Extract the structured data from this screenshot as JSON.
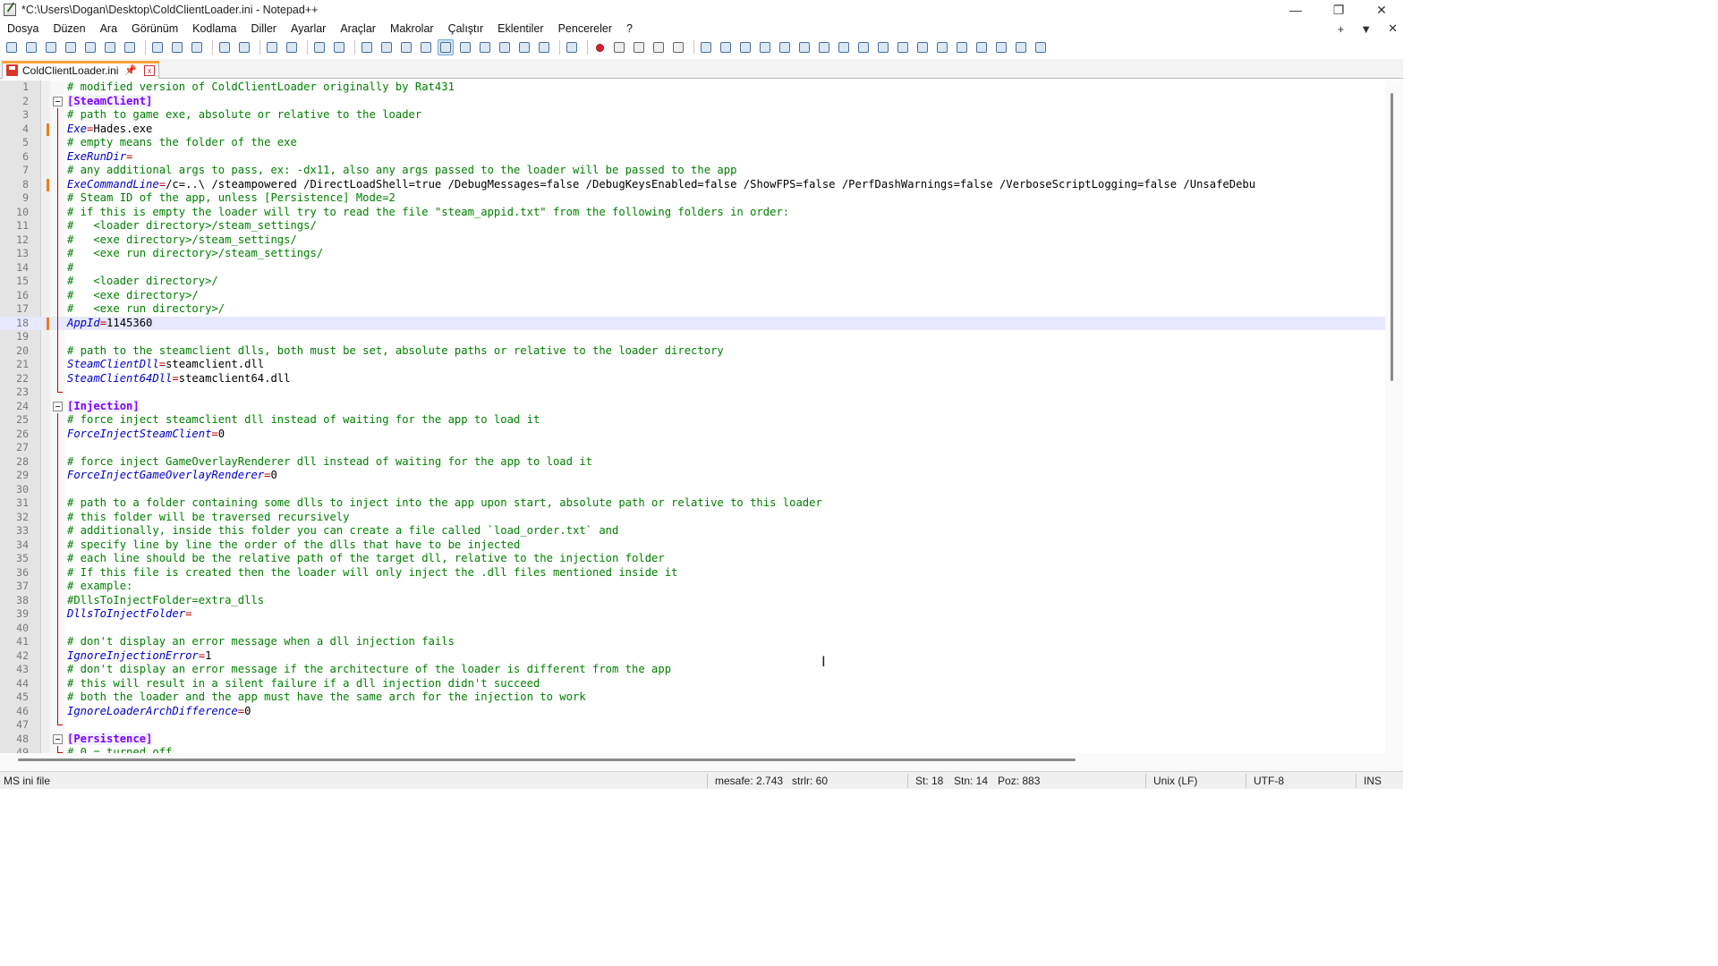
{
  "window": {
    "title": "*C:\\Users\\Dogan\\Desktop\\ColdClientLoader.ini - Notepad++",
    "minimize": "—",
    "restore": "❐",
    "close": "✕"
  },
  "menu": {
    "items": [
      "Dosya",
      "Düzen",
      "Ara",
      "Görünüm",
      "Kodlama",
      "Diller",
      "Ayarlar",
      "Araçlar",
      "Makrolar",
      "Çalıştır",
      "Eklentiler",
      "Pencereler",
      "?"
    ],
    "right": [
      "+",
      "▼",
      "✕"
    ]
  },
  "tab": {
    "label": "ColdClientLoader.ini",
    "pin": "📌",
    "close": "x"
  },
  "editor": {
    "lines": [
      {
        "n": "1",
        "t": "comment",
        "text": "# modified version of ColdClientLoader originally by Rat431"
      },
      {
        "n": "2",
        "t": "section",
        "text": "[SteamClient]"
      },
      {
        "n": "3",
        "t": "comment",
        "text": "# path to game exe, absolute or relative to the loader"
      },
      {
        "n": "4",
        "t": "kv",
        "key": "Exe",
        "val": "Hades.exe"
      },
      {
        "n": "5",
        "t": "comment",
        "text": "# empty means the folder of the exe"
      },
      {
        "n": "6",
        "t": "kv",
        "key": "ExeRunDir",
        "val": ""
      },
      {
        "n": "7",
        "t": "comment",
        "text": "# any additional args to pass, ex: -dx11, also any args passed to the loader will be passed to the app"
      },
      {
        "n": "8",
        "t": "kv",
        "key": "ExeCommandLine",
        "val": "/c=..\\ /steampowered /DirectLoadShell=true /DebugMessages=false /DebugKeysEnabled=false /ShowFPS=false /PerfDashWarnings=false /VerboseScriptLogging=false /UnsafeDebu"
      },
      {
        "n": "9",
        "t": "comment",
        "text": "# Steam ID of the app, unless [Persistence] Mode=2"
      },
      {
        "n": "10",
        "t": "comment",
        "text": "# if this is empty the loader will try to read the file \"steam_appid.txt\" from the following folders in order:"
      },
      {
        "n": "11",
        "t": "comment",
        "text": "#   <loader directory>/steam_settings/"
      },
      {
        "n": "12",
        "t": "comment",
        "text": "#   <exe directory>/steam_settings/"
      },
      {
        "n": "13",
        "t": "comment",
        "text": "#   <exe run directory>/steam_settings/"
      },
      {
        "n": "14",
        "t": "comment",
        "text": "#"
      },
      {
        "n": "15",
        "t": "comment",
        "text": "#   <loader directory>/"
      },
      {
        "n": "16",
        "t": "comment",
        "text": "#   <exe directory>/"
      },
      {
        "n": "17",
        "t": "comment",
        "text": "#   <exe run directory>/"
      },
      {
        "n": "18",
        "t": "kv",
        "key": "AppId",
        "val": "1145360"
      },
      {
        "n": "19",
        "t": "blank",
        "text": ""
      },
      {
        "n": "20",
        "t": "comment",
        "text": "# path to the steamclient dlls, both must be set, absolute paths or relative to the loader directory"
      },
      {
        "n": "21",
        "t": "kv",
        "key": "SteamClientDll",
        "val": "steamclient.dll"
      },
      {
        "n": "22",
        "t": "kv",
        "key": "SteamClient64Dll",
        "val": "steamclient64.dll"
      },
      {
        "n": "23",
        "t": "blank",
        "text": ""
      },
      {
        "n": "24",
        "t": "section",
        "text": "[Injection]"
      },
      {
        "n": "25",
        "t": "comment",
        "text": "# force inject steamclient dll instead of waiting for the app to load it"
      },
      {
        "n": "26",
        "t": "kv",
        "key": "ForceInjectSteamClient",
        "val": "0"
      },
      {
        "n": "27",
        "t": "blank",
        "text": ""
      },
      {
        "n": "28",
        "t": "comment",
        "text": "# force inject GameOverlayRenderer dll instead of waiting for the app to load it"
      },
      {
        "n": "29",
        "t": "kv",
        "key": "ForceInjectGameOverlayRenderer",
        "val": "0"
      },
      {
        "n": "30",
        "t": "blank",
        "text": ""
      },
      {
        "n": "31",
        "t": "comment",
        "text": "# path to a folder containing some dlls to inject into the app upon start, absolute path or relative to this loader"
      },
      {
        "n": "32",
        "t": "comment",
        "text": "# this folder will be traversed recursively"
      },
      {
        "n": "33",
        "t": "comment",
        "text": "# additionally, inside this folder you can create a file called `load_order.txt` and"
      },
      {
        "n": "34",
        "t": "comment",
        "text": "# specify line by line the order of the dlls that have to be injected"
      },
      {
        "n": "35",
        "t": "comment",
        "text": "# each line should be the relative path of the target dll, relative to the injection folder"
      },
      {
        "n": "36",
        "t": "comment",
        "text": "# If this file is created then the loader will only inject the .dll files mentioned inside it"
      },
      {
        "n": "37",
        "t": "comment",
        "text": "# example:"
      },
      {
        "n": "38",
        "t": "comment",
        "text": "#DllsToInjectFolder=extra_dlls"
      },
      {
        "n": "39",
        "t": "kv",
        "key": "DllsToInjectFolder",
        "val": ""
      },
      {
        "n": "40",
        "t": "blank",
        "text": ""
      },
      {
        "n": "41",
        "t": "comment",
        "text": "# don't display an error message when a dll injection fails"
      },
      {
        "n": "42",
        "t": "kv",
        "key": "IgnoreInjectionError",
        "val": "1"
      },
      {
        "n": "43",
        "t": "comment",
        "text": "# don't display an error message if the architecture of the loader is different from the app"
      },
      {
        "n": "44",
        "t": "comment",
        "text": "# this will result in a silent failure if a dll injection didn't succeed"
      },
      {
        "n": "45",
        "t": "comment",
        "text": "# both the loader and the app must have the same arch for the injection to work"
      },
      {
        "n": "46",
        "t": "kv",
        "key": "IgnoreLoaderArchDifference",
        "val": "0"
      },
      {
        "n": "47",
        "t": "blank",
        "text": ""
      },
      {
        "n": "48",
        "t": "section",
        "text": "[Persistence]"
      },
      {
        "n": "49",
        "t": "comment",
        "text": "# 0 = turned off"
      }
    ],
    "changed_lines": [
      "4",
      "8",
      "18"
    ],
    "highlight_lines": [
      "18"
    ],
    "fold_section_lines": [
      "2",
      "24",
      "48"
    ]
  },
  "statusbar": {
    "filetype": "MS ini file",
    "length": "mesafe: 2.743",
    "lines": "strlr: 60",
    "line": "St: 18",
    "col": "Stn: 14",
    "pos": "Poz: 883",
    "eol": "Unix (LF)",
    "encoding": "UTF-8",
    "mode": "INS"
  },
  "colors": {
    "comment": "#008000",
    "section": "#8000ff",
    "key": "#0000c8",
    "equals": "#c00000",
    "change_marker": "#e8801f",
    "tab_accent": "#f8a23a"
  }
}
